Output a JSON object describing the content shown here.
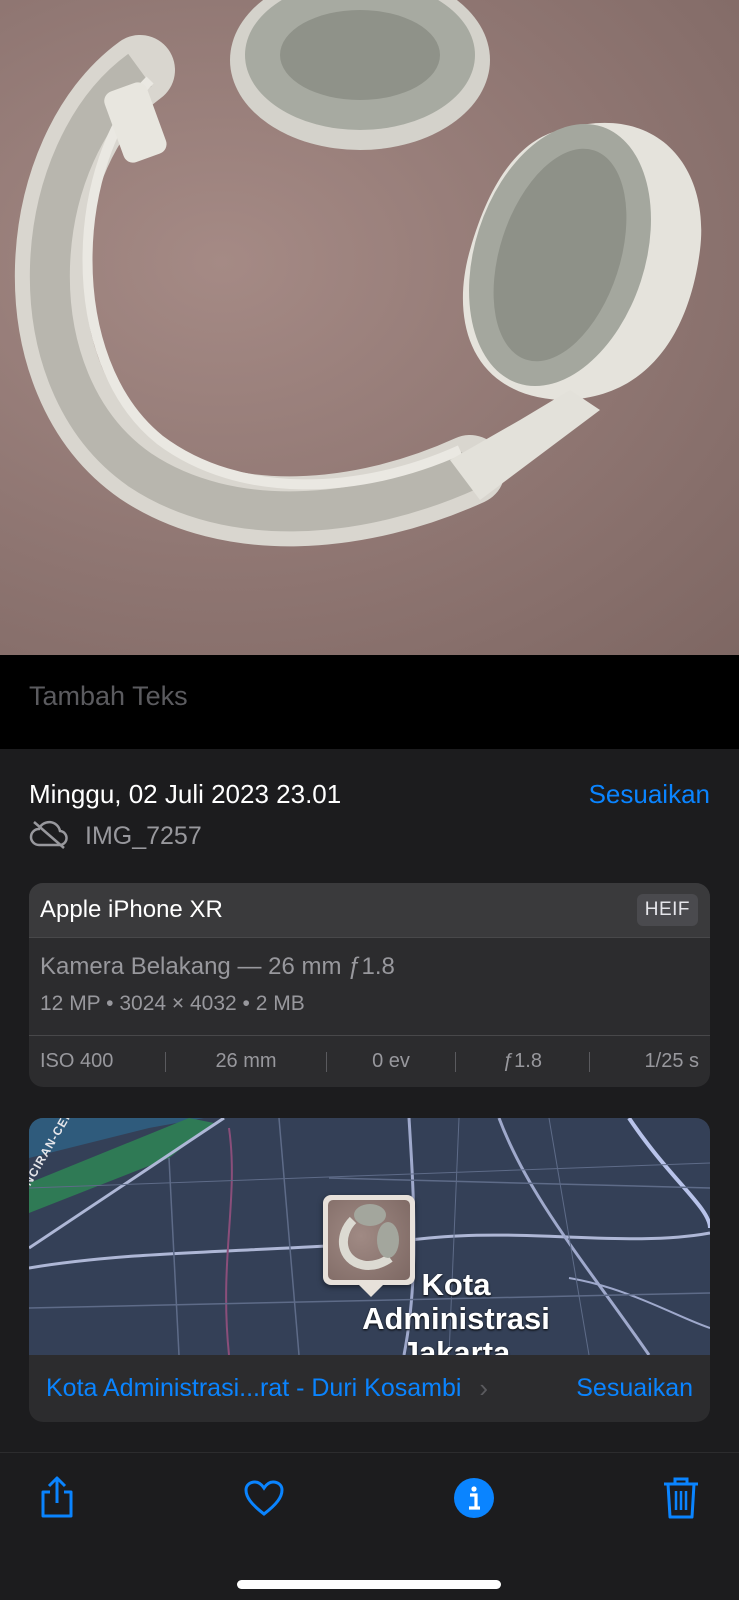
{
  "caption": {
    "placeholder": "Tambah Teks"
  },
  "info": {
    "date": "Minggu, 02 Juli 2023 23.01",
    "adjust_label": "Sesuaikan",
    "filename": "IMG_7257"
  },
  "meta": {
    "device": "Apple iPhone XR",
    "format": "HEIF",
    "lens": "Kamera Belakang — 26 mm ƒ1.8",
    "specs": "12 MP  •  3024 × 4032  •  2 MB",
    "exif": [
      "ISO 400",
      "26 mm",
      "0 ev",
      "ƒ1.8",
      "1/25 s"
    ]
  },
  "map": {
    "place_label": "Kota Administrasi Jakarta",
    "road_label_1": "AN-TOL-KUNCIRAN-CENGKARENG",
    "location": "Kota Administrasi...rat - Duri Kosambi",
    "adjust_label": "Sesuaikan"
  },
  "toolbar": {
    "icons": [
      "share-icon",
      "heart-icon",
      "info-icon",
      "trash-icon"
    ]
  },
  "colors": {
    "accent": "#0a84ff",
    "background": "#1c1c1e",
    "card": "#2c2c2e"
  }
}
